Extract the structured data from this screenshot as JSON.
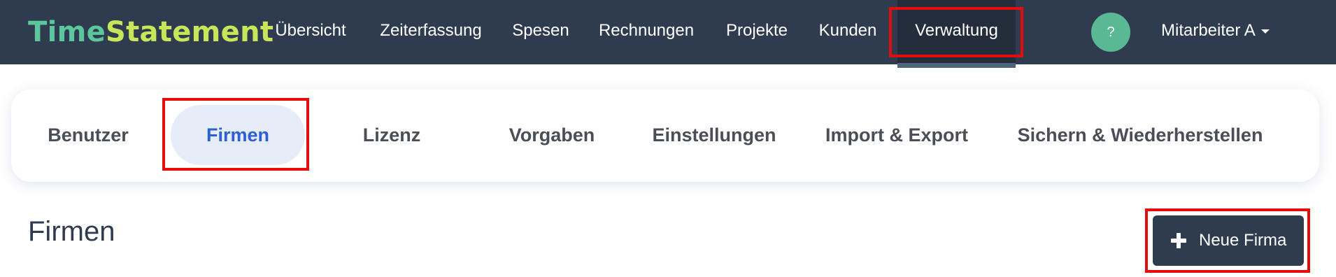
{
  "brand": {
    "part1": "Time",
    "part2": "Statement"
  },
  "nav": {
    "items": [
      {
        "label": "Übersicht"
      },
      {
        "label": "Zeiterfassung"
      },
      {
        "label": "Spesen"
      },
      {
        "label": "Rechnungen"
      },
      {
        "label": "Projekte"
      },
      {
        "label": "Kunden"
      },
      {
        "label": "Verwaltung",
        "active": true
      }
    ],
    "help_label": "?",
    "user_label": "Mitarbeiter A"
  },
  "tabs": [
    {
      "label": "Benutzer"
    },
    {
      "label": "Firmen",
      "active": true
    },
    {
      "label": "Lizenz"
    },
    {
      "label": "Vorgaben"
    },
    {
      "label": "Einstellungen"
    },
    {
      "label": "Import & Export"
    },
    {
      "label": "Sichern & Wiederherstellen"
    }
  ],
  "page": {
    "title": "Firmen",
    "new_button_label": "Neue Firma"
  },
  "colors": {
    "navbar_bg": "#2f3b4e",
    "brand_primary": "#5cc79c",
    "brand_secondary": "#c8e65a",
    "active_tab_text": "#2b5fd6",
    "highlight": "#e30d0d"
  }
}
